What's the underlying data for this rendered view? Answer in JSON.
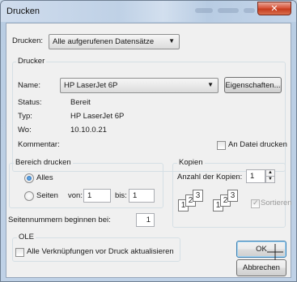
{
  "window": {
    "title": "Drucken",
    "close_glyph": "✕"
  },
  "print_selection": {
    "label": "Drucken:",
    "value": "Alle aufgerufenen Datensätze"
  },
  "printer": {
    "group_title": "Drucker",
    "name_label": "Name:",
    "name_value": "HP LaserJet 6P",
    "properties_button": "Eigenschaften...",
    "status_label": "Status:",
    "status_value": "Bereit",
    "type_label": "Typ:",
    "type_value": "HP LaserJet 6P",
    "where_label": "Wo:",
    "where_value": "10.10.0.21",
    "comment_label": "Kommentar:",
    "print_to_file_label": "An Datei drucken"
  },
  "range": {
    "group_title": "Bereich drucken",
    "all_label": "Alles",
    "pages_label": "Seiten",
    "from_label": "von:",
    "from_value": "1",
    "to_label": "bis:",
    "to_value": "1"
  },
  "copies": {
    "group_title": "Kopien",
    "count_label": "Anzahl der Kopien:",
    "count_value": "1",
    "collate_label": "Sortieren",
    "collate_pages": [
      "1",
      "2",
      "3"
    ]
  },
  "page_numbering": {
    "label": "Seitennummern beginnen bei:",
    "value": "1"
  },
  "ole": {
    "group_title": "OLE",
    "update_links_label": "Alle Verknüpfungen vor Druck aktualisieren"
  },
  "buttons": {
    "ok": "OK",
    "cancel": "Abbrechen"
  }
}
